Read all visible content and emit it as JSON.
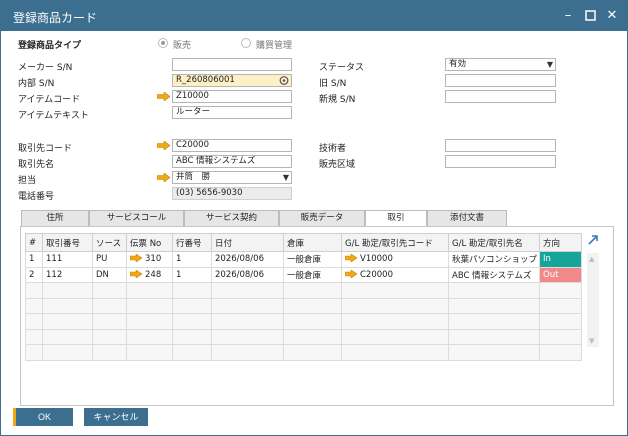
{
  "window": {
    "title": "登録商品カード"
  },
  "header": {
    "item_type_label": "登録商品タイプ",
    "radio_sales": "販売",
    "radio_purchasing": "購買管理"
  },
  "left_fields": [
    {
      "label": "メーカー S/N",
      "value": ""
    },
    {
      "label": "内部 S/N",
      "value": "R_260806001"
    },
    {
      "label": "アイテムコード",
      "value": "Z10000"
    },
    {
      "label": "アイテムテキスト",
      "value": "ルーター"
    }
  ],
  "right_fields": [
    {
      "label": "ステータス",
      "value": "有効"
    },
    {
      "label": "旧 S/N",
      "value": ""
    },
    {
      "label": "新規 S/N",
      "value": ""
    }
  ],
  "partner_fields": [
    {
      "label": "取引先コード",
      "value": "C20000"
    },
    {
      "label": "取引先名",
      "value": "ABC 情報システムズ"
    },
    {
      "label": "担当",
      "value": "井筒　勝"
    },
    {
      "label": "電話番号",
      "value": "(03) 5656-9030"
    }
  ],
  "service_fields": [
    {
      "label": "技術者",
      "value": ""
    },
    {
      "label": "販売区域",
      "value": ""
    }
  ],
  "tabs": [
    "住所",
    "サービスコール",
    "サービス契約",
    "販売データ",
    "取引",
    "添付文書"
  ],
  "active_tab": "取引",
  "grid": {
    "columns": [
      "#",
      "取引番号",
      "ソース",
      "伝票 No",
      "行番号",
      "日付",
      "倉庫",
      "G/L 勘定/取引先コード",
      "G/L 勘定/取引先名",
      "方向"
    ],
    "rows": [
      {
        "num": "1",
        "trans": "111",
        "source": "PU",
        "doc": "310",
        "line": "1",
        "date": "2026/08/06",
        "wh": "一般倉庫",
        "gl_code": "V10000",
        "gl_name": "秋葉パソコンショップ",
        "dir": "In"
      },
      {
        "num": "2",
        "trans": "112",
        "source": "DN",
        "doc": "248",
        "line": "1",
        "date": "2026/08/06",
        "wh": "一般倉庫",
        "gl_code": "C20000",
        "gl_name": "ABC 情報システムズ",
        "dir": "Out"
      }
    ]
  },
  "buttons": {
    "ok": "OK",
    "cancel": "キャンセル"
  },
  "colors": {
    "titlebar": "#3b6e8f",
    "link_arrow": "#f0a818",
    "dir_in": "#17a59a",
    "dir_out": "#f08a8a"
  }
}
